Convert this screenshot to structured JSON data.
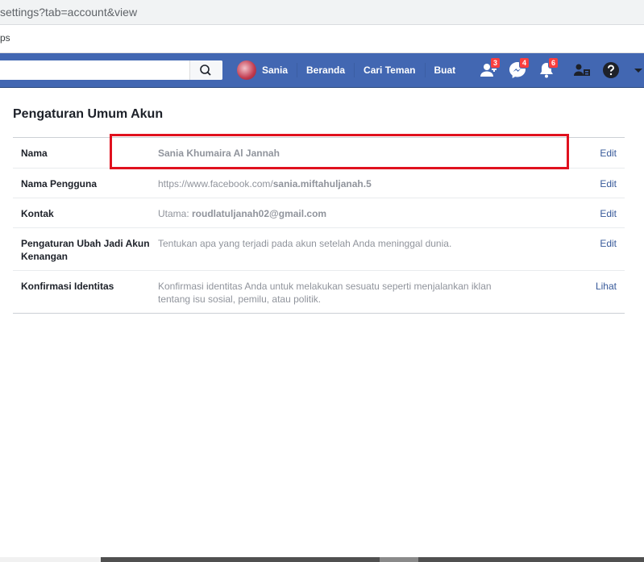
{
  "browser": {
    "url": "settings?tab=account&view",
    "bookmarks_label": "ps"
  },
  "topbar": {
    "user_name": "Sania",
    "nav": [
      "Beranda",
      "Cari Teman",
      "Buat"
    ],
    "badges": {
      "friends": "3",
      "messages": "4",
      "notifications": "6"
    },
    "colors": {
      "bar": "#4267b2",
      "badge": "#fa3e3e"
    }
  },
  "settings": {
    "title": "Pengaturan Umum Akun",
    "rows": [
      {
        "label": "Nama",
        "value": "Sania Khumaira Al Jannah",
        "action": "Edit"
      },
      {
        "label": "Nama Pengguna",
        "value_prefix": "https://www.facebook.com/",
        "value_bold": "sania.miftahuljanah.5",
        "action": "Edit"
      },
      {
        "label": "Kontak",
        "value_prefix": "Utama: ",
        "value_bold": "roudlatuljanah02@gmail.com",
        "action": "Edit"
      },
      {
        "label": "Pengaturan Ubah Jadi Akun Kenangan",
        "value": "Tentukan apa yang terjadi pada akun setelah Anda meninggal dunia.",
        "action": "Edit"
      },
      {
        "label": "Konfirmasi Identitas",
        "value": "Konfirmasi identitas Anda untuk melakukan sesuatu seperti menjalankan iklan tentang isu sosial, pemilu, atau politik.",
        "action": "Lihat"
      }
    ]
  },
  "annotation": {
    "color": "#e0111e"
  }
}
